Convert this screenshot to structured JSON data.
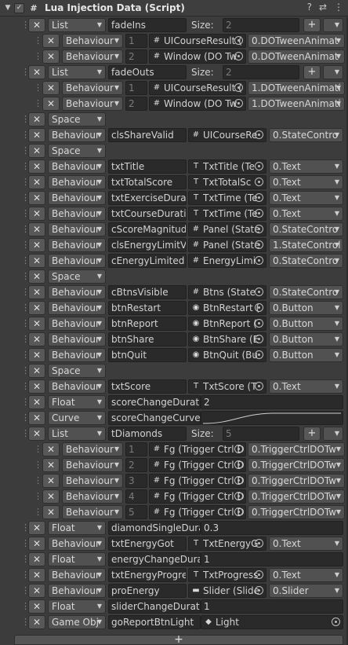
{
  "header": {
    "title": "Lua Injection Data (Script)",
    "fold_icon": "triangle-down-icon",
    "script_icon": "#",
    "icons": [
      "help-icon",
      "preset-icon",
      "more-icon"
    ]
  },
  "footer": {
    "add_label": "+"
  },
  "rows": [
    {
      "kind": "list",
      "type": "List",
      "name": "fadeIns",
      "size_label": "Size:",
      "size": "2"
    },
    {
      "kind": "item",
      "type": "Behaviour",
      "index": "1",
      "obj": "UICourseResult (",
      "obj_icon": "#",
      "value": "0.DOTweenAnimat"
    },
    {
      "kind": "item",
      "type": "Behaviour",
      "index": "2",
      "obj": "Window (DO Tw",
      "obj_icon": "#",
      "value": "0.DOTweenAnimat"
    },
    {
      "kind": "list",
      "type": "List",
      "name": "fadeOuts",
      "size_label": "Size:",
      "size": "2"
    },
    {
      "kind": "item",
      "type": "Behaviour",
      "index": "1",
      "obj": "UICourseResult (",
      "obj_icon": "#",
      "value": "1.DOTweenAnimati"
    },
    {
      "kind": "item",
      "type": "Behaviour",
      "index": "2",
      "obj": "Window (DO Tw",
      "obj_icon": "#",
      "value": "1.DOTweenAnimati"
    },
    {
      "kind": "space",
      "type": "Space"
    },
    {
      "kind": "beh",
      "type": "Behaviour",
      "name": "clsShareValid",
      "obj": "UICourseRe",
      "obj_icon": "#",
      "value": "0.StateContro"
    },
    {
      "kind": "space",
      "type": "Space"
    },
    {
      "kind": "beh",
      "type": "Behaviour",
      "name": "txtTitle",
      "obj": "TxtTitle (Te",
      "obj_icon": "T",
      "value": "0.Text"
    },
    {
      "kind": "beh",
      "type": "Behaviour",
      "name": "txtTotalScore",
      "obj": "TxtTotalSc",
      "obj_icon": "T",
      "value": "0.Text"
    },
    {
      "kind": "beh",
      "type": "Behaviour",
      "name": "txtExerciseDurati",
      "obj": "TxtTime (Te",
      "obj_icon": "T",
      "value": "0.Text"
    },
    {
      "kind": "beh",
      "type": "Behaviour",
      "name": "txtCourseDuration",
      "obj": "TxtTime (Te",
      "obj_icon": "T",
      "value": "0.Text"
    },
    {
      "kind": "beh",
      "type": "Behaviour",
      "name": "cScoreMagnitude",
      "obj": "Panel (State",
      "obj_icon": "#",
      "value": "0.StateContro"
    },
    {
      "kind": "beh",
      "type": "Behaviour",
      "name": "clsEnergyLimitVis",
      "obj": "Panel (State",
      "obj_icon": "#",
      "value": "1.StateControl"
    },
    {
      "kind": "beh",
      "type": "Behaviour",
      "name": "cEnergyLimited",
      "obj": "EnergyLimi",
      "obj_icon": "#",
      "value": "0.StateContro"
    },
    {
      "kind": "space",
      "type": "Space"
    },
    {
      "kind": "beh",
      "type": "Behaviour",
      "name": "cBtnsVisible",
      "obj": "Btns (State",
      "obj_icon": "#",
      "value": "0.StateContro"
    },
    {
      "kind": "beh",
      "type": "Behaviour",
      "name": "btnRestart",
      "obj": "BtnRestart (",
      "obj_icon": "◉",
      "value": "0.Button"
    },
    {
      "kind": "beh",
      "type": "Behaviour",
      "name": "btnReport",
      "obj": "BtnReport (",
      "obj_icon": "◉",
      "value": "0.Button"
    },
    {
      "kind": "beh",
      "type": "Behaviour",
      "name": "btnShare",
      "obj": "BtnShare (E",
      "obj_icon": "◉",
      "value": "0.Button"
    },
    {
      "kind": "beh",
      "type": "Behaviour",
      "name": "btnQuit",
      "obj": "BtnQuit (Bu",
      "obj_icon": "◉",
      "value": "0.Button"
    },
    {
      "kind": "space",
      "type": "Space"
    },
    {
      "kind": "beh",
      "type": "Behaviour",
      "name": "txtScore",
      "obj": "TxtScore (T",
      "obj_icon": "T",
      "value": "0.Text"
    },
    {
      "kind": "float",
      "type": "Float",
      "name": "scoreChangeDuratic",
      "value": "2"
    },
    {
      "kind": "curve",
      "type": "Curve",
      "name": "scoreChangeCurve"
    },
    {
      "kind": "list",
      "type": "List",
      "name": "tDiamonds",
      "size_label": "Size:",
      "size": "5"
    },
    {
      "kind": "item",
      "type": "Behaviour",
      "index": "1",
      "obj": "Fg (Trigger Ctrl D",
      "obj_icon": "#",
      "value": "0.TriggerCtrlDOTw"
    },
    {
      "kind": "item",
      "type": "Behaviour",
      "index": "2",
      "obj": "Fg (Trigger Ctrl D",
      "obj_icon": "#",
      "value": "0.TriggerCtrlDOTw"
    },
    {
      "kind": "item",
      "type": "Behaviour",
      "index": "3",
      "obj": "Fg (Trigger Ctrl D",
      "obj_icon": "#",
      "value": "0.TriggerCtrlDOTw"
    },
    {
      "kind": "item",
      "type": "Behaviour",
      "index": "4",
      "obj": "Fg (Trigger Ctrl D",
      "obj_icon": "#",
      "value": "0.TriggerCtrlDOTw"
    },
    {
      "kind": "item",
      "type": "Behaviour",
      "index": "5",
      "obj": "Fg (Trigger Ctrl D",
      "obj_icon": "#",
      "value": "0.TriggerCtrlDOTw"
    },
    {
      "kind": "float",
      "type": "Float",
      "name": "diamondSingleDurat",
      "value": "0.3"
    },
    {
      "kind": "beh",
      "type": "Behaviour",
      "name": "txtEnergyGot",
      "obj": "TxtEnergyG",
      "obj_icon": "T",
      "value": "0.Text"
    },
    {
      "kind": "float",
      "type": "Float",
      "name": "energyChangeDurat",
      "value": "1"
    },
    {
      "kind": "beh",
      "type": "Behaviour",
      "name": "txtEnergyProgres",
      "obj": "TxtProgress",
      "obj_icon": "T",
      "value": "0.Text"
    },
    {
      "kind": "beh",
      "type": "Behaviour",
      "name": "proEnergy",
      "obj": "Slider (Slide",
      "obj_icon": "▬",
      "value": "0.Slider"
    },
    {
      "kind": "float",
      "type": "Float",
      "name": "sliderChangeDuratio",
      "value": "1"
    },
    {
      "kind": "go",
      "type": "Game Obj",
      "name": "goReportBtnLight",
      "obj": "Light",
      "obj_icon": "◆"
    }
  ]
}
